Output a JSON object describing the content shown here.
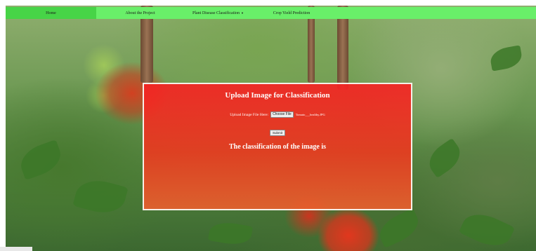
{
  "nav": {
    "items": [
      {
        "label": "Home",
        "active": true
      },
      {
        "label": "About the Project",
        "active": false
      },
      {
        "label": "Plant Disease Classification",
        "active": false,
        "dropdown": true
      },
      {
        "label": "Crop Yield Prediction",
        "active": false
      }
    ],
    "caret_icon": "chevron-down-icon",
    "bar_color": "#69ef69",
    "active_color": "#47d447"
  },
  "panel": {
    "title": "Upload Image for Classification",
    "upload_label": "Upload Image File Here:",
    "choose_button": "Choose File",
    "file_name": "Tomato___healthy.JPG",
    "submit_button": "Submit",
    "result_text": "The classification of the image is"
  },
  "colors": {
    "panel_top": "#f52323",
    "panel_bottom": "#eb5f2d",
    "panel_border": "#f5f0e8"
  }
}
